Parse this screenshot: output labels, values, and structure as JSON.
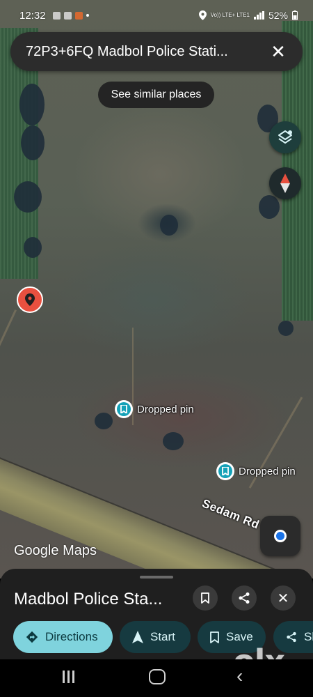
{
  "status_bar": {
    "time": "12:32",
    "network": "Vo)) LTE+ LTE1",
    "battery": "52%"
  },
  "search": {
    "query": "72P3+6FQ Madbol Police Stati...",
    "close_icon": "close-icon"
  },
  "chips": {
    "similar_places": "See similar places"
  },
  "map": {
    "road_label": "Sedam Rd",
    "dropped_pins": [
      {
        "label": "Dropped pin"
      },
      {
        "label": "Dropped pin"
      }
    ],
    "branding_google": "Google",
    "branding_maps": "Maps",
    "colors": {
      "selected_pin": "#e8503f",
      "dropped_pin": "#16a2b8",
      "location_dot": "#1a73e8"
    }
  },
  "bottom_sheet": {
    "title": "Madbol Police Sta...",
    "actions": [
      {
        "label": "Directions",
        "icon": "directions-icon"
      },
      {
        "label": "Start",
        "icon": "navigation-arrow-icon"
      },
      {
        "label": "Save",
        "icon": "bookmark-icon"
      },
      {
        "label": "Sh",
        "icon": "share-icon"
      }
    ],
    "colors": {
      "primary_action": "#7fd3dd",
      "secondary_action": "#163a40"
    }
  },
  "watermark": {
    "text": "olx"
  }
}
